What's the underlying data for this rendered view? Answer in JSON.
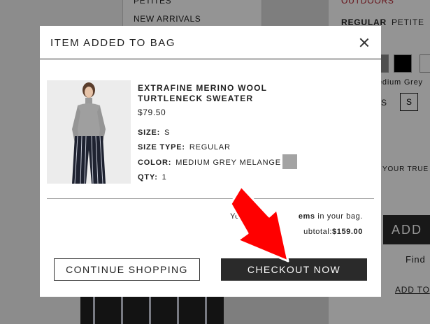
{
  "background": {
    "nav_items": [
      "PETITES",
      "NEW ARRIVALS"
    ],
    "fits": [
      "REGULAR",
      "PETITE"
    ],
    "top_label": "OUTDOORS",
    "color_label": "edium Grey",
    "size_values": [
      "S",
      "S"
    ],
    "fit_note": "YOUR TRUE",
    "add_label": "ADD",
    "find_label": "Find",
    "add_to_label": "ADD TO"
  },
  "modal": {
    "title": "ITEM ADDED TO BAG",
    "product": {
      "name": "EXTRAFINE MERINO WOOL TURTLENECK SWEATER",
      "price": "$79.50",
      "size_label": "SIZE:",
      "size_value": "S",
      "size_type_label": "SIZE TYPE:",
      "size_type_value": "REGULAR",
      "color_label": "COLOR:",
      "color_value": "MEDIUM GREY MELANGE",
      "color_hex": "#a3a3a3",
      "qty_label": "QTY:",
      "qty_value": "1"
    },
    "summary": {
      "items_prefix": "You",
      "items_bold": "ems",
      "items_suffix": "in your bag.",
      "subtotal_label": "ubtotal:",
      "subtotal_value": "$159.00"
    },
    "buttons": {
      "continue": "CONTINUE SHOPPING",
      "checkout": "CHECKOUT NOW"
    }
  },
  "annotation": {
    "arrow_color": "#ff0000"
  }
}
